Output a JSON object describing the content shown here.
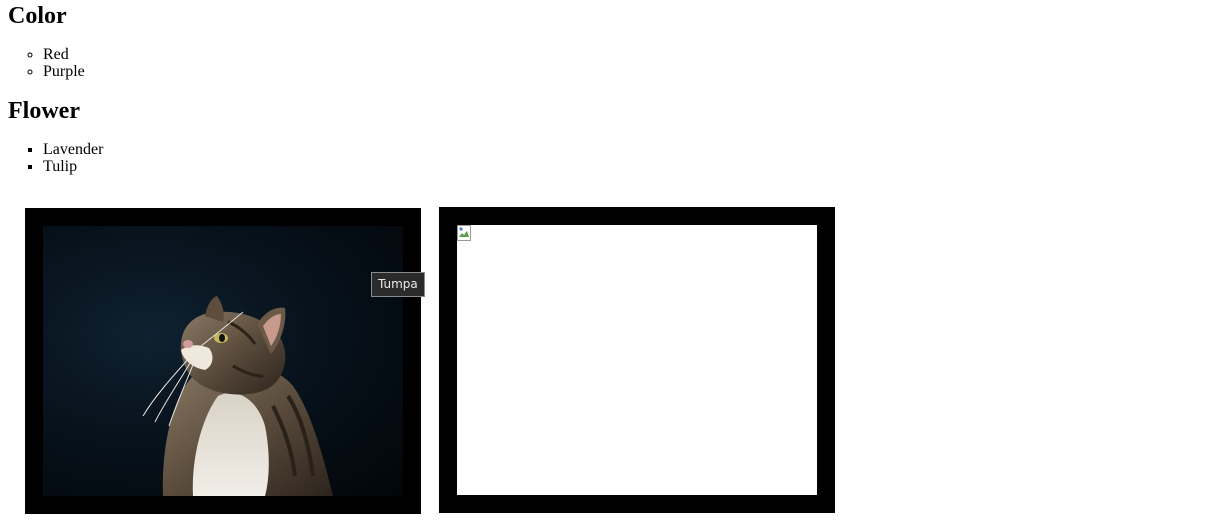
{
  "sections": [
    {
      "heading": "Color",
      "items": [
        "Red",
        "Purple"
      ]
    },
    {
      "heading": "Flower",
      "items": [
        "Lavender",
        "Tulip"
      ]
    }
  ],
  "images": {
    "cat": {
      "subject": "cat-photo",
      "frame_color": "#000000"
    },
    "broken": {
      "subject": "broken-image-placeholder",
      "frame_color": "#000000"
    }
  },
  "tooltip": {
    "text": "Tumpa"
  }
}
